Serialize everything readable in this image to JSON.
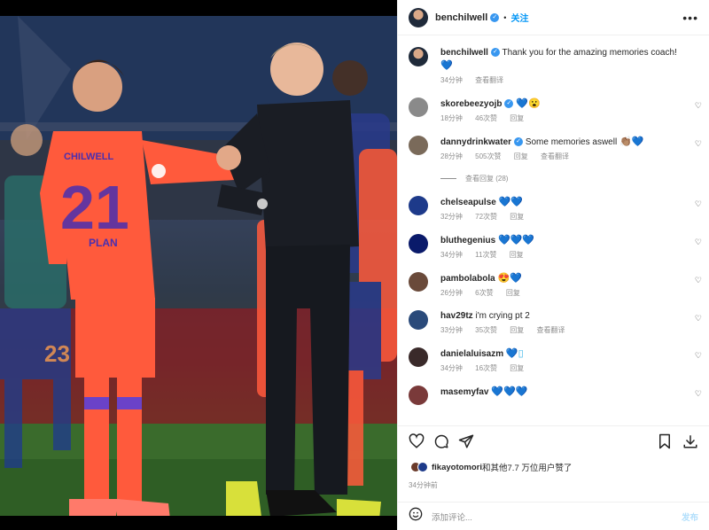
{
  "post": {
    "author": "benchilwell",
    "follow_label": "关注",
    "separator": "•",
    "more_label": "•••",
    "caption": "Thank you for the amazing memories coach!",
    "caption_time": "34分钟",
    "caption_translate": "查看翻译"
  },
  "photo": {
    "player_name": "CHILWELL",
    "player_number": "21",
    "sponsor": "PLAN",
    "bg_player_number": "23"
  },
  "comments": [
    {
      "user": "skorebeezyojb",
      "verified": true,
      "text": "",
      "emoji": "💙😮",
      "time": "18分钟",
      "likes": "46次赞",
      "reply": "回复",
      "translate": "",
      "avatar_color": "#8a8a8a"
    },
    {
      "user": "dannydrinkwater",
      "verified": true,
      "text": "Some memories aswell",
      "emoji": "👏🏽💙",
      "time": "28分钟",
      "likes": "505次赞",
      "reply": "回复",
      "translate": "查看翻译",
      "avatar_color": "#7a6a5a"
    },
    {
      "user": "chelseapulse",
      "verified": false,
      "text": "",
      "emoji": "💙💙",
      "time": "32分钟",
      "likes": "72次赞",
      "reply": "回复",
      "translate": "",
      "avatar_color": "#1d3a8a"
    },
    {
      "user": "bluthegenius",
      "verified": false,
      "text": "",
      "emoji": "💙💙💙",
      "time": "34分钟",
      "likes": "11次赞",
      "reply": "回复",
      "translate": "",
      "avatar_color": "#0a1a6a"
    },
    {
      "user": "pambolabola",
      "verified": false,
      "text": "",
      "emoji": "😍💙",
      "time": "26分钟",
      "likes": "6次赞",
      "reply": "回复",
      "translate": "",
      "avatar_color": "#6a4a3a"
    },
    {
      "user": "hav29tz",
      "verified": false,
      "text": "i'm crying pt 2",
      "emoji": "",
      "time": "33分钟",
      "likes": "35次赞",
      "reply": "回复",
      "translate": "查看翻译",
      "avatar_color": "#2a4a7a"
    },
    {
      "user": "danielaluisazm",
      "verified": false,
      "text": "",
      "emoji": "💙▯",
      "time": "34分钟",
      "likes": "16次赞",
      "reply": "回复",
      "translate": "",
      "avatar_color": "#3a2a2a"
    },
    {
      "user": "masemyfav",
      "verified": false,
      "text": "",
      "emoji": "💙💙💙",
      "time": "",
      "likes": "",
      "reply": "",
      "translate": "",
      "avatar_color": "#7a3a3a"
    }
  ],
  "view_replies": "查看回复 (28)",
  "likes_line": {
    "user": "fikayotomori",
    "rest": "和其他7.7 万位用户赞了"
  },
  "time_ago": "34分钟前",
  "add_comment": {
    "placeholder": "添加评论...",
    "post_label": "发布"
  },
  "colors": {
    "accent": "#0095f6",
    "heart_blue": "#3ab4e8",
    "jersey": "#ff5a3c"
  }
}
